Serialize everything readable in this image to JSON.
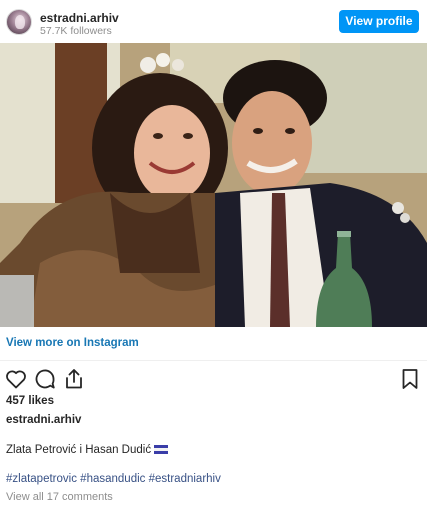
{
  "header": {
    "username": "estradni.arhiv",
    "followers": "57.7K followers",
    "view_profile_label": "View profile"
  },
  "post": {
    "view_more_label": "View more on Instagram",
    "likes": "457 likes",
    "caption_user": "estradni.arhiv",
    "caption_text": "Zlata Petrović i Hasan Dudić",
    "hashtags": [
      "#zlatapetrovic",
      "#hasandudic",
      "#estradniarhiv"
    ],
    "comments_link": "View all 17 comments"
  },
  "colors": {
    "accent": "#0095f6",
    "link": "#1877b4",
    "hashtag": "#385185",
    "muted": "#8e8e8e"
  },
  "icons": {
    "like": "heart-icon",
    "comment": "comment-icon",
    "share": "share-icon",
    "save": "bookmark-icon"
  }
}
